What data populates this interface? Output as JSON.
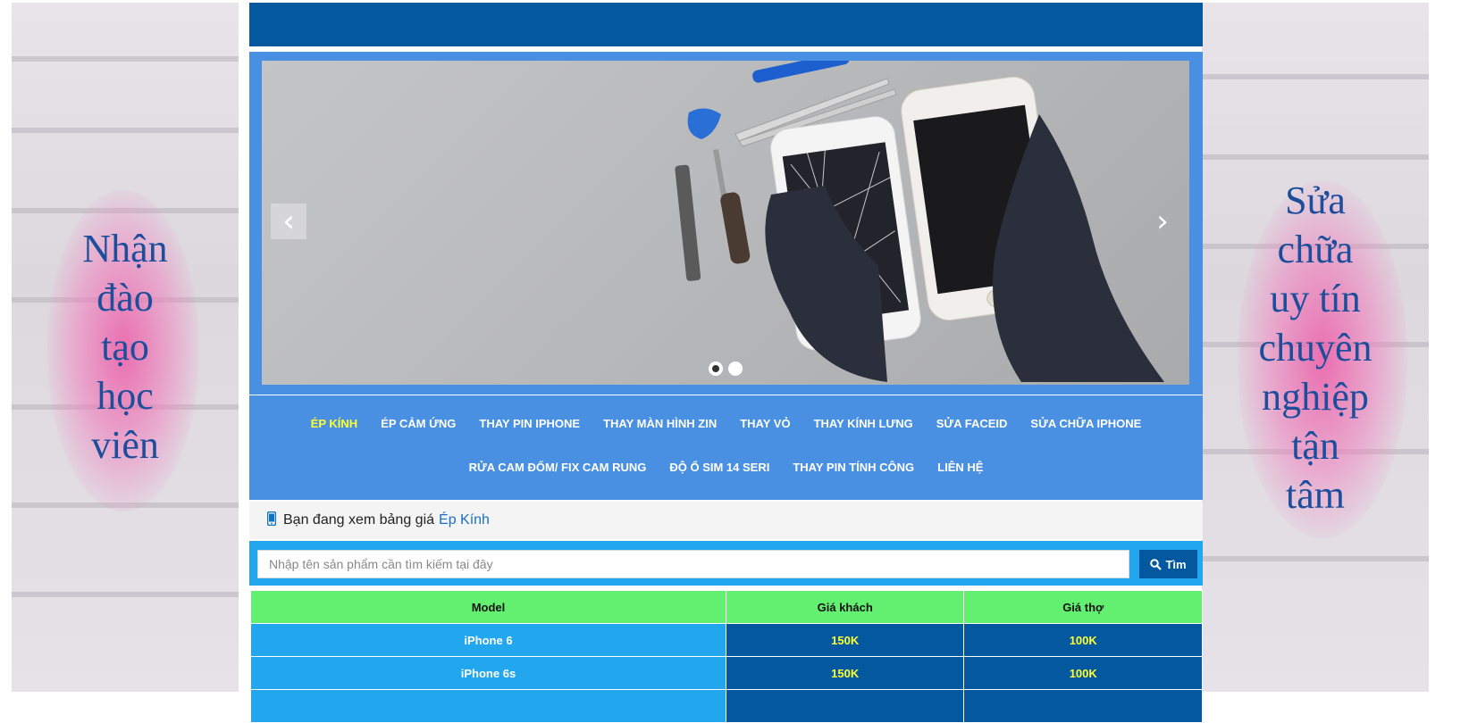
{
  "left_banner": {
    "lines": [
      "Nhận",
      "đào",
      "tạo",
      "học",
      "viên"
    ]
  },
  "right_banner": {
    "lines": [
      "Sửa",
      "chữa",
      "uy tín",
      "chuyên",
      "nghiệp",
      "tận",
      "tâm"
    ]
  },
  "slider": {
    "prev_arrow": "‹",
    "next_arrow": "›",
    "dots": 2,
    "active_dot": 0
  },
  "nav": {
    "row1": [
      "ÉP KÍNH",
      "ÉP CẢM ỨNG",
      "THAY PIN IPHONE",
      "THAY MÀN HÌNH ZIN",
      "THAY VỎ",
      "THAY KÍNH LƯNG",
      "SỬA FACEID",
      "SỬA CHỮA IPHONE"
    ],
    "row2": [
      "RỬA CAM ĐỐM/ FIX CAM RUNG",
      "ĐỘ Ổ SIM 14 SERI",
      "THAY PIN TÍNH CÔNG",
      "LIÊN HỆ"
    ],
    "active_item": "ÉP KÍNH"
  },
  "breadcrumb": {
    "prefix": "Bạn đang xem bảng giá",
    "current": "Ép Kính"
  },
  "search": {
    "placeholder": "Nhập tên sản phẩm cần tìm kiếm tại đây",
    "button_label": "Tìm"
  },
  "table": {
    "headers": [
      "Model",
      "Giá khách",
      "Giá thợ"
    ],
    "rows": [
      [
        "iPhone 6",
        "150K",
        "100K"
      ],
      [
        "iPhone 6s",
        "150K",
        "100K"
      ],
      [
        "",
        "",
        ""
      ]
    ]
  },
  "colors": {
    "primary_dark": "#03589f",
    "nav_bg": "#4a90e2",
    "search_bg": "#22a7ee",
    "table_header": "#63ef70",
    "highlight_yellow": "#ffff33",
    "banner_text": "#1c4e9c"
  }
}
